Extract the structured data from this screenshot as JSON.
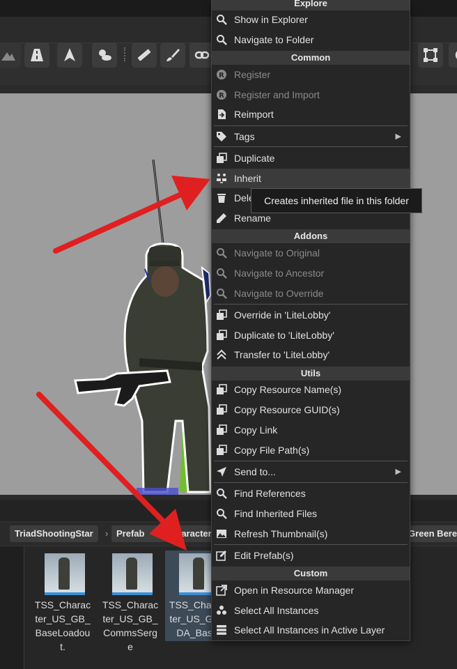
{
  "menu": {
    "sections": {
      "explore": "Explore",
      "common": "Common",
      "addons": "Addons",
      "utils": "Utils",
      "custom": "Custom"
    },
    "items": {
      "show_in_explorer": "Show in Explorer",
      "navigate_to_folder": "Navigate to Folder",
      "register": "Register",
      "register_and_import": "Register and Import",
      "reimport": "Reimport",
      "tags": "Tags",
      "duplicate": "Duplicate",
      "inherit": "Inherit",
      "delete": "Dele",
      "rename": "Rename",
      "navigate_to_original": "Navigate to Original",
      "navigate_to_ancestor": "Navigate to Ancestor",
      "navigate_to_override": "Navigate to Override",
      "override_in": "Override in 'LiteLobby'",
      "duplicate_to": "Duplicate to 'LiteLobby'",
      "transfer_to": "Transfer to 'LiteLobby'",
      "copy_resource_name": "Copy Resource Name(s)",
      "copy_resource_guid": "Copy Resource GUID(s)",
      "copy_link": "Copy Link",
      "copy_file_path": "Copy File Path(s)",
      "send_to": "Send to...",
      "find_references": "Find References",
      "find_inherited_files": "Find Inherited Files",
      "refresh_thumbnail": "Refresh Thumbnail(s)",
      "edit_prefab": "Edit Prefab(s)",
      "open_in_resource_manager": "Open in Resource Manager",
      "select_all_instances": "Select All Instances",
      "select_all_instances_active_layer": "Select All Instances in Active Layer"
    }
  },
  "tooltip": "Creates inherited file in this folder",
  "breadcrumb": {
    "items": [
      "TriadShootingStar",
      "Prefab",
      "Character",
      "Green Beret"
    ]
  },
  "assets": [
    {
      "name": "TSS_Character_US_GB_BaseLoadout."
    },
    {
      "name": "TSS_Character_US_GB_CommsSerge"
    },
    {
      "name": "TSS_Character_US_GB_DA_Base"
    }
  ],
  "colors": {
    "arrow": "#e02020",
    "menu_bg": "#262626",
    "section_bg": "#3a3a3a",
    "selection": "#3d4a57"
  }
}
